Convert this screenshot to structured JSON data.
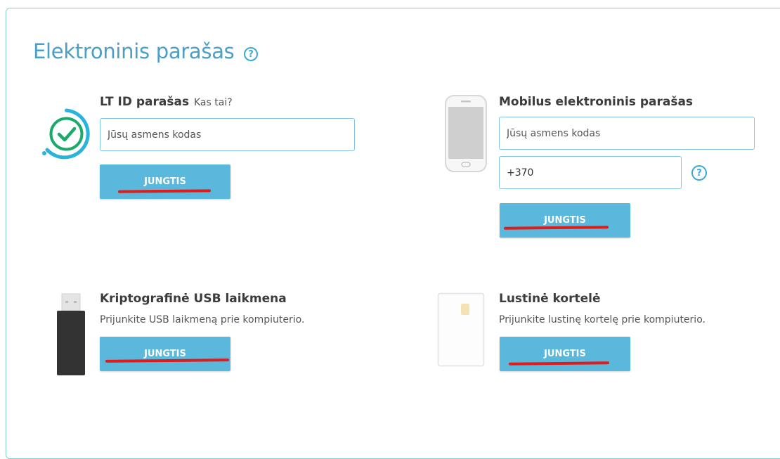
{
  "page": {
    "title": "Elektroninis parašas",
    "help": "?"
  },
  "ltid": {
    "title": "LT ID parašas",
    "link": "Kas tai?",
    "input_placeholder": "Jūsų asmens kodas",
    "button": "JUNGTIS"
  },
  "mobile": {
    "title": "Mobilus elektroninis parašas",
    "personal_code_placeholder": "Jūsų asmens kodas",
    "phone_value": "+370",
    "help": "?",
    "button": "JUNGTIS"
  },
  "usb": {
    "title": "Kriptografinė USB laikmena",
    "description": "Prijunkite USB laikmeną prie kompiuterio.",
    "button": "JUNGTIS"
  },
  "card": {
    "title": "Lustinė kortelė",
    "description": "Prijunkite lustinę kortelę prie kompiuterio.",
    "button": "JUNGTIS"
  },
  "colors": {
    "accent": "#5bb8dd",
    "title": "#4a9fc6",
    "border": "#7fcfc6",
    "highlight": "#e11a1a"
  },
  "icons": [
    "check-circle-icon",
    "smartphone-icon",
    "usb-stick-icon",
    "smart-card-icon",
    "help-icon"
  ]
}
